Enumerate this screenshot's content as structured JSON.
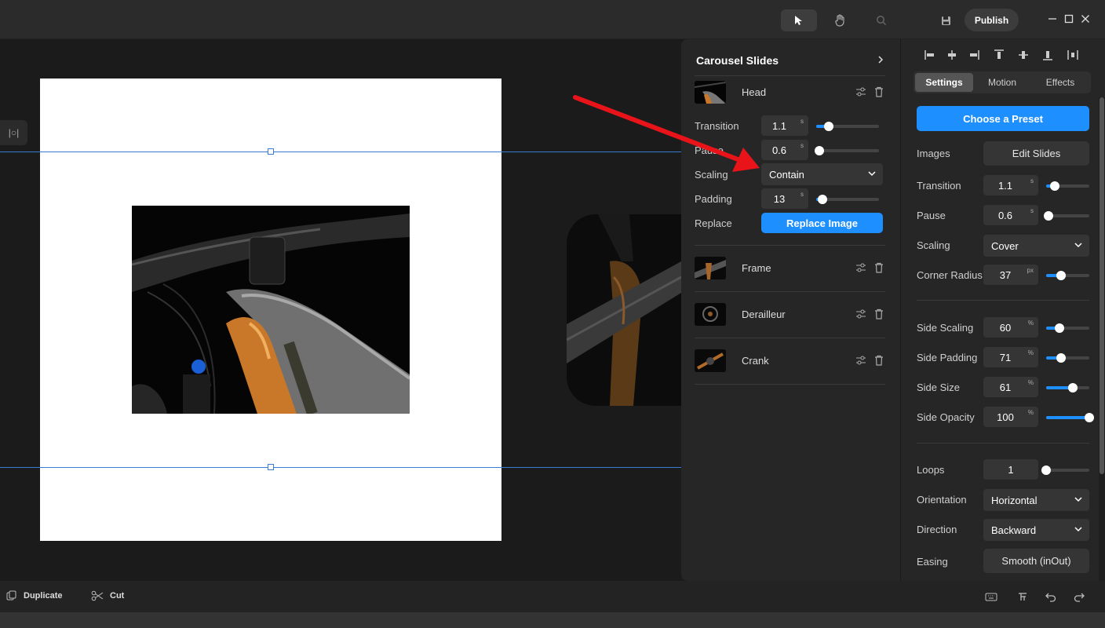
{
  "topbar": {
    "tools": [
      "select-tool",
      "hand-tool",
      "zoom-tool"
    ],
    "publish_label": "Publish",
    "window_controls": [
      "minimize",
      "maximize",
      "close"
    ]
  },
  "canvas": {
    "side_toggle_label": "|○|"
  },
  "carousel": {
    "title": "Carousel Slides",
    "slides": [
      {
        "name": "Head"
      },
      {
        "name": "Frame"
      },
      {
        "name": "Derailleur"
      },
      {
        "name": "Crank"
      }
    ],
    "head_settings": {
      "transition_label": "Transition",
      "transition_value": "1.1",
      "transition_unit": "s",
      "transition_level": 0.2,
      "pause_label": "Pause",
      "pause_value": "0.6",
      "pause_unit": "s",
      "pause_level": 0.05,
      "scaling_label": "Scaling",
      "scaling_value": "Contain",
      "padding_label": "Padding",
      "padding_value": "13",
      "padding_unit": "s",
      "padding_level": 0.1,
      "replace_label": "Replace",
      "replace_button": "Replace Image"
    }
  },
  "inspector": {
    "tabs": [
      "Settings",
      "Motion",
      "Effects"
    ],
    "active_tab": "Settings",
    "preset_button": "Choose a Preset",
    "images_label": "Images",
    "edit_slides_button": "Edit Slides",
    "transition_label": "Transition",
    "transition_value": "1.1",
    "transition_unit": "s",
    "transition_level": 0.2,
    "pause_label": "Pause",
    "pause_value": "0.6",
    "pause_unit": "s",
    "pause_level": 0.05,
    "scaling_label": "Scaling",
    "scaling_value": "Cover",
    "corner_radius_label": "Corner Radius",
    "corner_radius_value": "37",
    "corner_radius_unit": "px",
    "corner_radius_level": 0.35,
    "side_scaling_label": "Side Scaling",
    "side_scaling_value": "60",
    "side_scaling_unit": "%",
    "side_scaling_level": 0.3,
    "side_padding_label": "Side Padding",
    "side_padding_value": "71",
    "side_padding_unit": "%",
    "side_padding_level": 0.35,
    "side_size_label": "Side Size",
    "side_size_value": "61",
    "side_size_unit": "%",
    "side_size_level": 0.61,
    "side_opacity_label": "Side Opacity",
    "side_opacity_value": "100",
    "side_opacity_unit": "%",
    "side_opacity_level": 1.0,
    "loops_label": "Loops",
    "loops_value": "1",
    "loops_level": 0.0,
    "orientation_label": "Orientation",
    "orientation_value": "Horizontal",
    "direction_label": "Direction",
    "direction_value": "Backward",
    "easing_label": "Easing",
    "easing_value": "Smooth (inOut)"
  },
  "bottombar": {
    "duplicate_label": "Duplicate",
    "cut_label": "Cut"
  },
  "colors": {
    "accent": "#1e8fff",
    "arrow": "#e8141a",
    "bike_orange": "#c9782a"
  }
}
